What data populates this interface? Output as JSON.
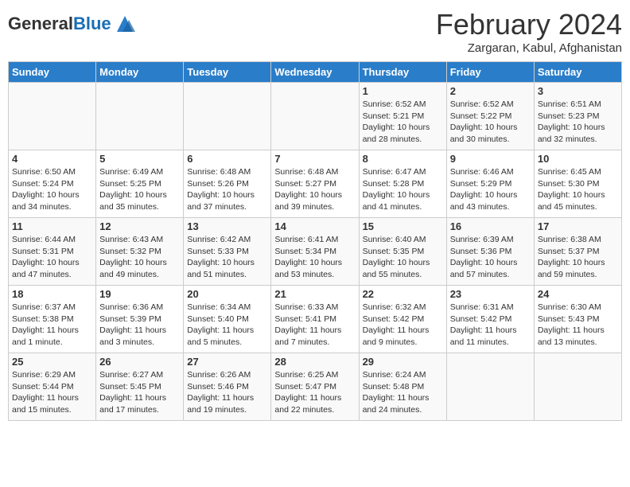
{
  "header": {
    "logo_general": "General",
    "logo_blue": "Blue",
    "month_title": "February 2024",
    "location": "Zargaran, Kabul, Afghanistan"
  },
  "days_of_week": [
    "Sunday",
    "Monday",
    "Tuesday",
    "Wednesday",
    "Thursday",
    "Friday",
    "Saturday"
  ],
  "weeks": [
    [
      {
        "day": "",
        "info": ""
      },
      {
        "day": "",
        "info": ""
      },
      {
        "day": "",
        "info": ""
      },
      {
        "day": "",
        "info": ""
      },
      {
        "day": "1",
        "info": "Sunrise: 6:52 AM\nSunset: 5:21 PM\nDaylight: 10 hours\nand 28 minutes."
      },
      {
        "day": "2",
        "info": "Sunrise: 6:52 AM\nSunset: 5:22 PM\nDaylight: 10 hours\nand 30 minutes."
      },
      {
        "day": "3",
        "info": "Sunrise: 6:51 AM\nSunset: 5:23 PM\nDaylight: 10 hours\nand 32 minutes."
      }
    ],
    [
      {
        "day": "4",
        "info": "Sunrise: 6:50 AM\nSunset: 5:24 PM\nDaylight: 10 hours\nand 34 minutes."
      },
      {
        "day": "5",
        "info": "Sunrise: 6:49 AM\nSunset: 5:25 PM\nDaylight: 10 hours\nand 35 minutes."
      },
      {
        "day": "6",
        "info": "Sunrise: 6:48 AM\nSunset: 5:26 PM\nDaylight: 10 hours\nand 37 minutes."
      },
      {
        "day": "7",
        "info": "Sunrise: 6:48 AM\nSunset: 5:27 PM\nDaylight: 10 hours\nand 39 minutes."
      },
      {
        "day": "8",
        "info": "Sunrise: 6:47 AM\nSunset: 5:28 PM\nDaylight: 10 hours\nand 41 minutes."
      },
      {
        "day": "9",
        "info": "Sunrise: 6:46 AM\nSunset: 5:29 PM\nDaylight: 10 hours\nand 43 minutes."
      },
      {
        "day": "10",
        "info": "Sunrise: 6:45 AM\nSunset: 5:30 PM\nDaylight: 10 hours\nand 45 minutes."
      }
    ],
    [
      {
        "day": "11",
        "info": "Sunrise: 6:44 AM\nSunset: 5:31 PM\nDaylight: 10 hours\nand 47 minutes."
      },
      {
        "day": "12",
        "info": "Sunrise: 6:43 AM\nSunset: 5:32 PM\nDaylight: 10 hours\nand 49 minutes."
      },
      {
        "day": "13",
        "info": "Sunrise: 6:42 AM\nSunset: 5:33 PM\nDaylight: 10 hours\nand 51 minutes."
      },
      {
        "day": "14",
        "info": "Sunrise: 6:41 AM\nSunset: 5:34 PM\nDaylight: 10 hours\nand 53 minutes."
      },
      {
        "day": "15",
        "info": "Sunrise: 6:40 AM\nSunset: 5:35 PM\nDaylight: 10 hours\nand 55 minutes."
      },
      {
        "day": "16",
        "info": "Sunrise: 6:39 AM\nSunset: 5:36 PM\nDaylight: 10 hours\nand 57 minutes."
      },
      {
        "day": "17",
        "info": "Sunrise: 6:38 AM\nSunset: 5:37 PM\nDaylight: 10 hours\nand 59 minutes."
      }
    ],
    [
      {
        "day": "18",
        "info": "Sunrise: 6:37 AM\nSunset: 5:38 PM\nDaylight: 11 hours\nand 1 minute."
      },
      {
        "day": "19",
        "info": "Sunrise: 6:36 AM\nSunset: 5:39 PM\nDaylight: 11 hours\nand 3 minutes."
      },
      {
        "day": "20",
        "info": "Sunrise: 6:34 AM\nSunset: 5:40 PM\nDaylight: 11 hours\nand 5 minutes."
      },
      {
        "day": "21",
        "info": "Sunrise: 6:33 AM\nSunset: 5:41 PM\nDaylight: 11 hours\nand 7 minutes."
      },
      {
        "day": "22",
        "info": "Sunrise: 6:32 AM\nSunset: 5:42 PM\nDaylight: 11 hours\nand 9 minutes."
      },
      {
        "day": "23",
        "info": "Sunrise: 6:31 AM\nSunset: 5:42 PM\nDaylight: 11 hours\nand 11 minutes."
      },
      {
        "day": "24",
        "info": "Sunrise: 6:30 AM\nSunset: 5:43 PM\nDaylight: 11 hours\nand 13 minutes."
      }
    ],
    [
      {
        "day": "25",
        "info": "Sunrise: 6:29 AM\nSunset: 5:44 PM\nDaylight: 11 hours\nand 15 minutes."
      },
      {
        "day": "26",
        "info": "Sunrise: 6:27 AM\nSunset: 5:45 PM\nDaylight: 11 hours\nand 17 minutes."
      },
      {
        "day": "27",
        "info": "Sunrise: 6:26 AM\nSunset: 5:46 PM\nDaylight: 11 hours\nand 19 minutes."
      },
      {
        "day": "28",
        "info": "Sunrise: 6:25 AM\nSunset: 5:47 PM\nDaylight: 11 hours\nand 22 minutes."
      },
      {
        "day": "29",
        "info": "Sunrise: 6:24 AM\nSunset: 5:48 PM\nDaylight: 11 hours\nand 24 minutes."
      },
      {
        "day": "",
        "info": ""
      },
      {
        "day": "",
        "info": ""
      }
    ]
  ]
}
